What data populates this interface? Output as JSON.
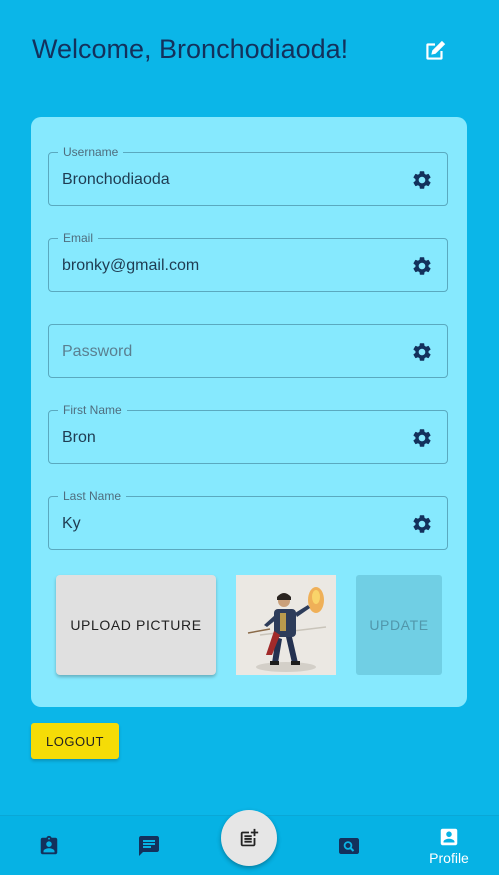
{
  "header": {
    "welcome_text": "Welcome, Bronchodiaoda!"
  },
  "form": {
    "username": {
      "label": "Username",
      "value": "Bronchodiaoda"
    },
    "email": {
      "label": "Email",
      "value": "bronky@gmail.com"
    },
    "password": {
      "placeholder": "Password",
      "value": ""
    },
    "first_name": {
      "label": "First Name",
      "value": "Bron"
    },
    "last_name": {
      "label": "Last Name",
      "value": "Ky"
    }
  },
  "actions": {
    "upload_label": "UPLOAD PICTURE",
    "update_label": "UPDATE",
    "update_disabled": true,
    "logout_label": "LOGOUT"
  },
  "profile_picture": {
    "alt": "profile picture",
    "icon": "character-portrait"
  },
  "bottom_nav": {
    "items": [
      {
        "icon": "contact-badge-icon",
        "label": ""
      },
      {
        "icon": "chat-icon",
        "label": ""
      },
      {
        "icon": "new-post-icon",
        "label": ""
      },
      {
        "icon": "search-icon",
        "label": ""
      },
      {
        "icon": "person-icon",
        "label": "Profile",
        "active": true
      }
    ]
  },
  "colors": {
    "background": "#0bb6e8",
    "card": "#86e9fe",
    "title": "#13315c",
    "logout": "#f5dc07",
    "upload": "#e0e0e0",
    "update_disabled": "#70cfe4"
  }
}
